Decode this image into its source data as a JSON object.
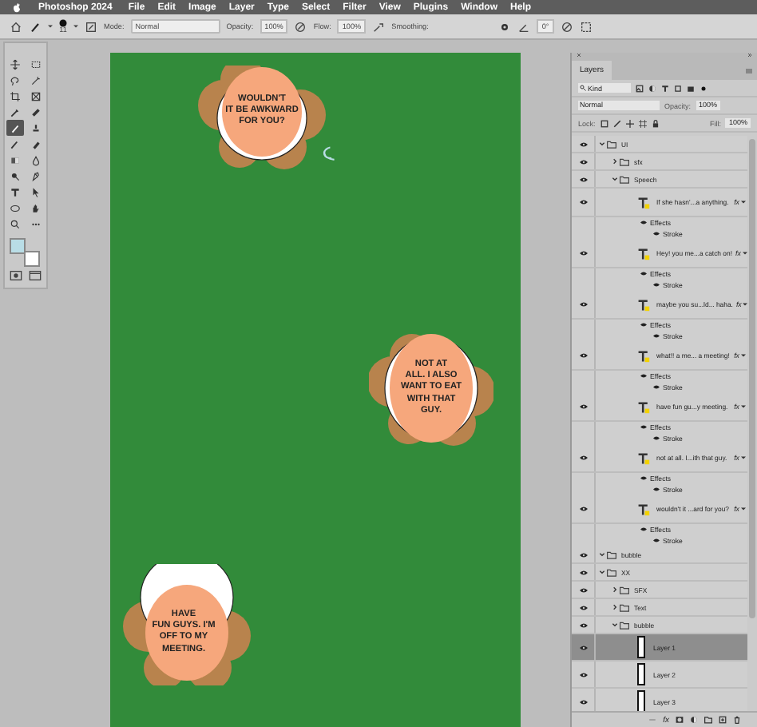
{
  "menu_bar": {
    "app_name": "Photoshop 2024",
    "items": [
      "File",
      "Edit",
      "Image",
      "Layer",
      "Type",
      "Select",
      "Filter",
      "View",
      "Plugins",
      "Window",
      "Help"
    ]
  },
  "options_bar": {
    "brush_size": "11",
    "mode_label": "Mode:",
    "mode": "Normal",
    "opacity_label": "Opacity:",
    "opacity": "100%",
    "flow_label": "Flow:",
    "flow": "100%",
    "smoothing_label": "Smoothing:",
    "angle": "0°"
  },
  "toolbox": {
    "tools": [
      {
        "selected": false
      },
      {
        "selected": false
      },
      {
        "selected": false
      },
      {
        "selected": false
      },
      {
        "selected": false
      },
      {
        "selected": false
      },
      {
        "selected": false
      },
      {
        "selected": false
      },
      {
        "selected": true
      },
      {
        "selected": false
      },
      {
        "selected": false
      },
      {
        "selected": false
      },
      {
        "selected": false
      },
      {
        "selected": false
      },
      {
        "selected": false
      },
      {
        "selected": false
      },
      {
        "selected": false
      },
      {
        "selected": false
      },
      {
        "selected": false
      },
      {
        "selected": false
      },
      {
        "selected": false
      },
      {
        "selected": false
      }
    ],
    "swatches": [
      {
        "color": "#b9dde6"
      },
      {
        "color": "#ffffff"
      }
    ]
  },
  "canvas": {
    "bubbles": [
      {
        "text": "WOULDN'T\nIT BE AWKWARD\nFOR YOU?"
      },
      {
        "text": "NOT AT\nALL. I ALSO\nWANT TO EAT\nWITH THAT\nGUY."
      },
      {
        "text": "HAVE\nFUN GUYS. I'M\nOFF TO MY\nMEETING."
      }
    ]
  },
  "layers_panel": {
    "tab": "Layers",
    "filter": "Kind",
    "blend_mode": "Normal",
    "opacity_label": "Opacity:",
    "opacity": "100%",
    "lock_label": "Lock:",
    "fill_label": "Fill:",
    "fill": "100%",
    "footer_fx": "fx",
    "layers": [
      {
        "kind": "group",
        "name": "UI",
        "visible": true,
        "selected": false,
        "expanded": true,
        "children": [
          {
            "kind": "group",
            "name": "sfx",
            "visible": true,
            "selected": false,
            "expanded": false
          },
          {
            "kind": "group",
            "name": "Speech",
            "visible": true,
            "selected": false,
            "expanded": true,
            "children": [
              {
                "kind": "text",
                "name": "If she hasn'...a anything.",
                "visible": true,
                "selected": false,
                "badge": "fx",
                "effects_label": "Effects",
                "effects": [
                  "Stroke"
                ]
              },
              {
                "kind": "text",
                "name": "Hey! you me...a catch on!",
                "visible": true,
                "selected": false,
                "badge": "fx",
                "effects_label": "Effects",
                "effects": [
                  "Stroke"
                ]
              },
              {
                "kind": "text",
                "name": "maybe you su...ld... haha.",
                "visible": true,
                "selected": false,
                "badge": "fx",
                "effects_label": "Effects",
                "effects": [
                  "Stroke"
                ]
              },
              {
                "kind": "text",
                "name": "what!! a me... a meeting!",
                "visible": true,
                "selected": false,
                "badge": "fx",
                "effects_label": "Effects",
                "effects": [
                  "Stroke"
                ]
              },
              {
                "kind": "text",
                "name": "have fun gu...y meeting.",
                "visible": true,
                "selected": false,
                "badge": "fx",
                "effects_label": "Effects",
                "effects": [
                  "Stroke"
                ]
              },
              {
                "kind": "text",
                "name": "not at all. I...ith that guy.",
                "visible": true,
                "selected": false,
                "badge": "fx",
                "effects_label": "Effects",
                "effects": [
                  "Stroke"
                ]
              },
              {
                "kind": "text",
                "name": "wouldn't it ...ard for you?",
                "visible": true,
                "selected": false,
                "badge": "fx",
                "effects_label": "Effects",
                "effects": [
                  "Stroke"
                ]
              }
            ]
          }
        ]
      },
      {
        "kind": "group",
        "name": "bubble",
        "visible": true,
        "selected": false,
        "expanded": true
      },
      {
        "kind": "group",
        "name": "XX",
        "visible": true,
        "selected": false,
        "expanded": true,
        "children": [
          {
            "kind": "group",
            "name": "SFX",
            "visible": true,
            "selected": false,
            "expanded": false
          },
          {
            "kind": "group",
            "name": "Text",
            "visible": true,
            "selected": false,
            "expanded": false
          },
          {
            "kind": "group",
            "name": "bubble",
            "visible": true,
            "selected": false,
            "expanded": true,
            "children": [
              {
                "kind": "pixel",
                "name": "Layer 1",
                "visible": true,
                "selected": true
              },
              {
                "kind": "pixel",
                "name": "Layer 2",
                "visible": true,
                "selected": false
              },
              {
                "kind": "pixel",
                "name": "Layer 3",
                "visible": true,
                "selected": false
              }
            ]
          }
        ]
      }
    ]
  }
}
